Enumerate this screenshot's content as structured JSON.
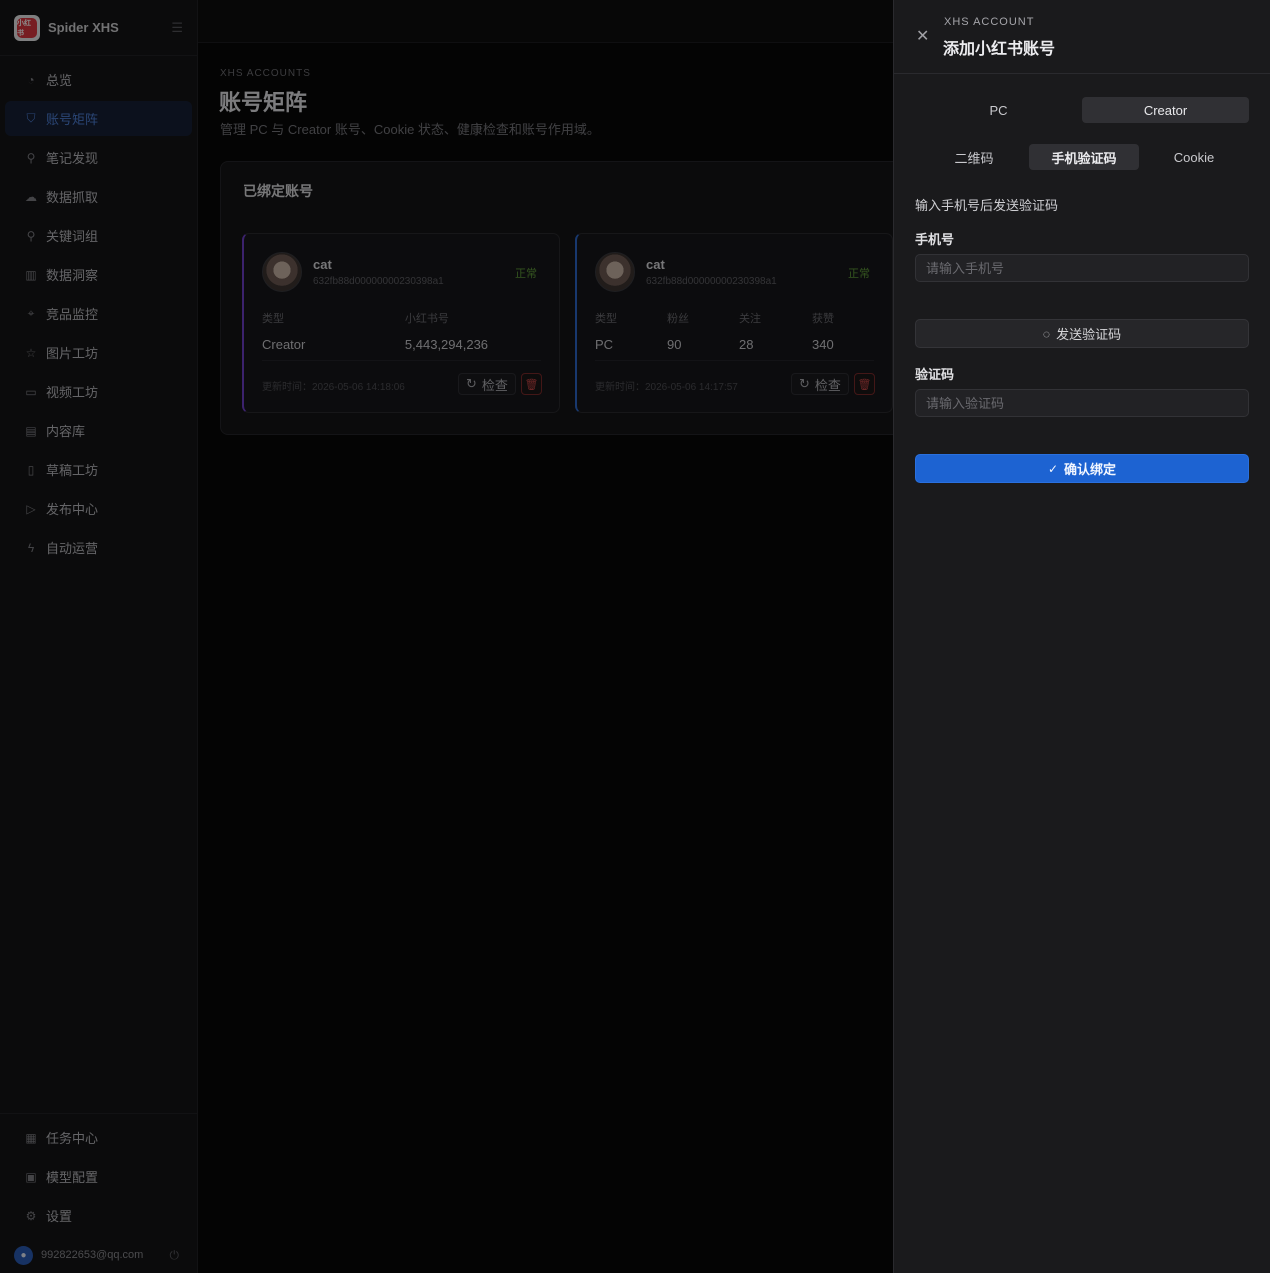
{
  "app": {
    "name": "Spider XHS",
    "logo_text": "小红书"
  },
  "sidebar": {
    "items": [
      {
        "label": "总览",
        "icon": "dashboard-icon",
        "glyph": "◔",
        "active": false
      },
      {
        "label": "账号矩阵",
        "icon": "shield-icon",
        "glyph": "⛉",
        "active": true
      },
      {
        "label": "笔记发现",
        "icon": "search-icon",
        "glyph": "⚲",
        "active": false
      },
      {
        "label": "数据抓取",
        "icon": "cloud-icon",
        "glyph": "☁",
        "active": false
      },
      {
        "label": "关键词组",
        "icon": "key-search-icon",
        "glyph": "⚲",
        "active": false
      },
      {
        "label": "数据洞察",
        "icon": "bar-chart-icon",
        "glyph": "▥",
        "active": false
      },
      {
        "label": "竞品监控",
        "icon": "target-icon",
        "glyph": "⌖",
        "active": false
      },
      {
        "label": "图片工坊",
        "icon": "star-icon",
        "glyph": "☆",
        "active": false
      },
      {
        "label": "视频工坊",
        "icon": "video-icon",
        "glyph": "▭",
        "active": false
      },
      {
        "label": "内容库",
        "icon": "library-icon",
        "glyph": "▤",
        "active": false
      },
      {
        "label": "草稿工坊",
        "icon": "draft-icon",
        "glyph": "▯",
        "active": false
      },
      {
        "label": "发布中心",
        "icon": "send-icon",
        "glyph": "▷",
        "active": false
      },
      {
        "label": "自动运营",
        "icon": "bolt-icon",
        "glyph": "ϟ",
        "active": false
      }
    ],
    "bottom_items": [
      {
        "label": "任务中心",
        "icon": "calendar-icon",
        "glyph": "▦"
      },
      {
        "label": "模型配置",
        "icon": "model-icon",
        "glyph": "▣"
      },
      {
        "label": "设置",
        "icon": "gear-icon",
        "glyph": "⚙"
      }
    ],
    "user_email": "992822653@qq.com"
  },
  "page": {
    "eyebrow": "XHS ACCOUNTS",
    "title": "账号矩阵",
    "subtitle": "管理 PC 与 Creator 账号、Cookie 状态、健康检查和账号作用域。",
    "panel_title": "已绑定账号"
  },
  "accounts": [
    {
      "name": "cat",
      "id": "632fb88d00000000230398a1",
      "status": "正常",
      "stats": [
        {
          "label": "类型",
          "value": "Creator"
        },
        {
          "label": "小红书号",
          "value": "5,443,294,236"
        }
      ],
      "updated": "更新时间：2026-05-06 14:18:06",
      "check_label": "检查"
    },
    {
      "name": "cat",
      "id": "632fb88d00000000230398a1",
      "status": "正常",
      "stats": [
        {
          "label": "类型",
          "value": "PC"
        },
        {
          "label": "粉丝",
          "value": "90"
        },
        {
          "label": "关注",
          "value": "28"
        },
        {
          "label": "获赞",
          "value": "340"
        }
      ],
      "updated": "更新时间：2026-05-06 14:17:57",
      "check_label": "检查"
    }
  ],
  "drawer": {
    "eyebrow": "XHS ACCOUNT",
    "title": "添加小红书账号",
    "platform_tabs": [
      {
        "label": "PC",
        "active": false
      },
      {
        "label": "Creator",
        "active": true
      }
    ],
    "method_tabs": [
      {
        "label": "二维码",
        "active": false
      },
      {
        "label": "手机验证码",
        "active": true
      },
      {
        "label": "Cookie",
        "active": false
      }
    ],
    "hint": "输入手机号后发送验证码",
    "phone_label": "手机号",
    "phone_placeholder": "请输入手机号",
    "send_code_label": "发送验证码",
    "code_label": "验证码",
    "code_placeholder": "请输入验证码",
    "confirm_label": "确认绑定"
  },
  "colors": {
    "accent": "#1d63d2",
    "active_nav": "#4d7fd6",
    "status_ok": "#5f9a3a",
    "danger": "#c24545"
  }
}
